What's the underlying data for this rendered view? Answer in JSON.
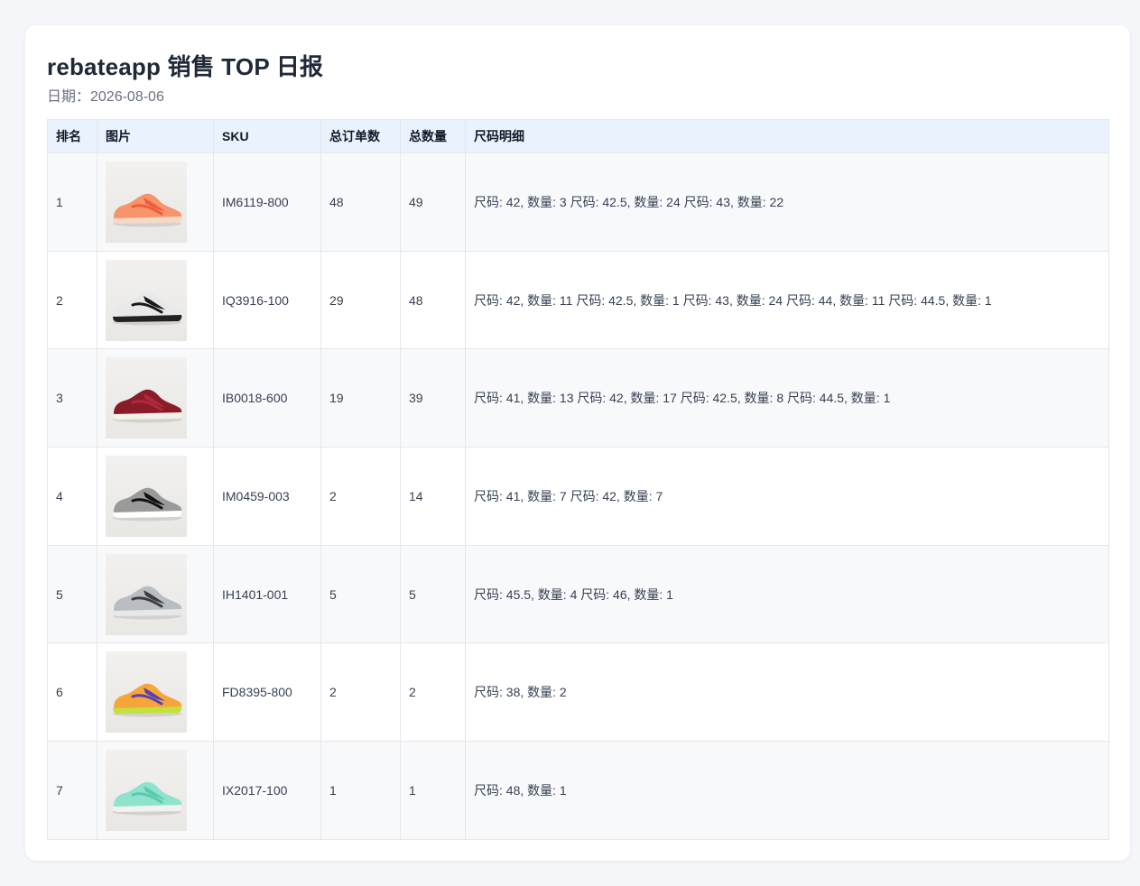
{
  "header": {
    "title": "rebateapp 销售 TOP 日报",
    "date": "日期：2026-08-06"
  },
  "table": {
    "columns": [
      "排名",
      "图片",
      "SKU",
      "总订单数",
      "总数量",
      "尺码明细"
    ],
    "rows": [
      {
        "rank": "1",
        "image_icon": "sneaker-orange-icon",
        "sku": "IM6119-800",
        "orders": "48",
        "qty": "49",
        "sizes": "尺码: 42, 数量: 3 尺码: 42.5, 数量: 24 尺码: 43, 数量: 22",
        "colors": {
          "upper": "#f7946c",
          "accent": "#ef5c3b",
          "sole": "#f4d9c8"
        }
      },
      {
        "rank": "2",
        "image_icon": "sneaker-white-black-icon",
        "sku": "IQ3916-100",
        "orders": "29",
        "qty": "48",
        "sizes": "尺码: 42, 数量: 11 尺码: 42.5, 数量: 1 尺码: 43, 数量: 24 尺码: 44, 数量: 11 尺码: 44.5, 数量: 1",
        "colors": {
          "upper": "#e9e9e9",
          "accent": "#1a1a1a",
          "sole": "#222222"
        }
      },
      {
        "rank": "3",
        "image_icon": "sneaker-burgundy-icon",
        "sku": "IB0018-600",
        "orders": "19",
        "qty": "39",
        "sizes": "尺码: 41, 数量: 13 尺码: 42, 数量: 17 尺码: 42.5, 数量: 8 尺码: 44.5, 数量: 1",
        "colors": {
          "upper": "#8a1c2a",
          "accent": "#b02a3a",
          "sole": "#f5f0ea"
        }
      },
      {
        "rank": "4",
        "image_icon": "sneaker-black-grey-icon",
        "sku": "IM0459-003",
        "orders": "2",
        "qty": "14",
        "sizes": "尺码: 41, 数量: 7 尺码: 42, 数量: 7",
        "colors": {
          "upper": "#9a9a9a",
          "accent": "#111111",
          "sole": "#ffffff"
        }
      },
      {
        "rank": "5",
        "image_icon": "sneaker-grey-icon",
        "sku": "IH1401-001",
        "orders": "5",
        "qty": "5",
        "sizes": "尺码: 45.5, 数量: 4 尺码: 46, 数量: 1",
        "colors": {
          "upper": "#b9bdc2",
          "accent": "#3a3d42",
          "sole": "#e6e8ea"
        }
      },
      {
        "rank": "6",
        "image_icon": "spike-orange-purple-icon",
        "sku": "FD8395-800",
        "orders": "2",
        "qty": "2",
        "sizes": "尺码: 38, 数量: 2",
        "colors": {
          "upper": "#f6a53a",
          "accent": "#5a3fb0",
          "sole": "#c4e03c"
        }
      },
      {
        "rank": "7",
        "image_icon": "sneaker-mint-icon",
        "sku": "IX2017-100",
        "orders": "1",
        "qty": "1",
        "sizes": "尺码: 48, 数量: 1",
        "colors": {
          "upper": "#8fe3cd",
          "accent": "#5bc9ad",
          "sole": "#f2f2ee"
        }
      }
    ]
  }
}
